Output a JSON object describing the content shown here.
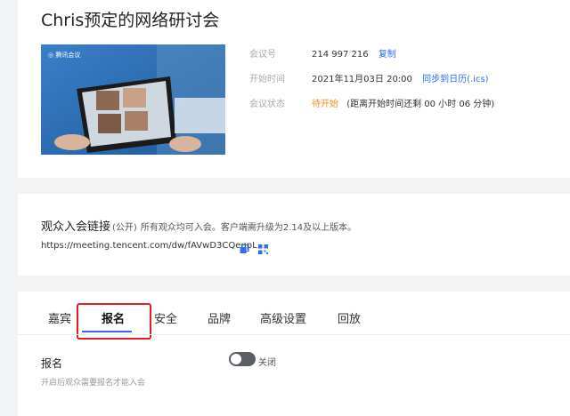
{
  "meeting": {
    "title": "Chris预定的网络研讨会",
    "meeting_id_label": "会议号",
    "meeting_id": "214 997 216",
    "copy_label": "复制",
    "start_time_label": "开始时间",
    "start_time": "2021年11月03日 20:00",
    "sync_calendar": "同步到日历(.ics)",
    "status_label": "会议状态",
    "status_value": "待开始",
    "status_detail": "(距离开始时间还剩 00 小时 06 分钟)",
    "colors": {
      "link": "#2d6cf6",
      "pending": "#f08c1e"
    }
  },
  "audience": {
    "title": "观众入会链接",
    "public_tag": "(公开)",
    "note": "所有观众均可入会。客户端需升级为2.14及以上版本。",
    "url": "https://meeting.tencent.com/dw/fAVwD3CQegpL",
    "icons": [
      "copy-icon",
      "qrcode-icon"
    ]
  },
  "tabs": [
    {
      "label": "嘉宾",
      "active": false
    },
    {
      "label": "报名",
      "active": true
    },
    {
      "label": "安全",
      "active": false
    },
    {
      "label": "品牌",
      "active": false
    },
    {
      "label": "高级设置",
      "active": false
    },
    {
      "label": "回放",
      "active": false
    }
  ],
  "registration": {
    "label": "报名",
    "description": "开启后观众需要报名才能入会",
    "toggle_label": "关闭",
    "enabled": false
  }
}
